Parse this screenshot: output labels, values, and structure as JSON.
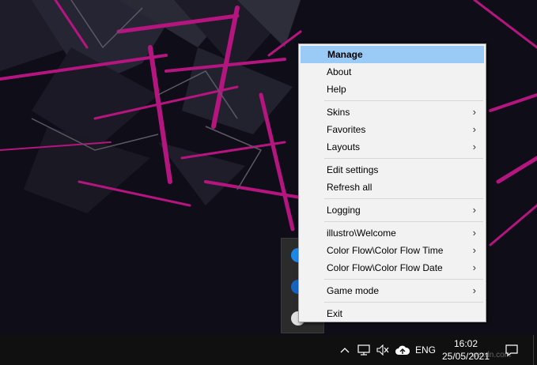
{
  "menu": {
    "groups": [
      [
        {
          "label": "Manage",
          "submenu": false,
          "highlighted": true
        },
        {
          "label": "About",
          "submenu": false
        },
        {
          "label": "Help",
          "submenu": false
        }
      ],
      [
        {
          "label": "Skins",
          "submenu": true
        },
        {
          "label": "Favorites",
          "submenu": true
        },
        {
          "label": "Layouts",
          "submenu": true
        }
      ],
      [
        {
          "label": "Edit settings",
          "submenu": false
        },
        {
          "label": "Refresh all",
          "submenu": false
        }
      ],
      [
        {
          "label": "Logging",
          "submenu": true
        }
      ],
      [
        {
          "label": "illustro\\Welcome",
          "submenu": true
        },
        {
          "label": "Color Flow\\Color Flow Time",
          "submenu": true
        },
        {
          "label": "Color Flow\\Color Flow Date",
          "submenu": true
        }
      ],
      [
        {
          "label": "Game mode",
          "submenu": true
        }
      ],
      [
        {
          "label": "Exit",
          "submenu": false
        }
      ]
    ],
    "submenu_glyph": "›"
  },
  "taskbar": {
    "language": "ENG",
    "time": "16:02",
    "date": "25/05/2021",
    "icons": [
      "chevron-up-icon",
      "network-icon",
      "volume-muted-icon",
      "cloud-upload-icon",
      "notification-icon"
    ]
  },
  "watermark": "wsxdn.com",
  "colors": {
    "menu_highlight": "#99cbf6",
    "menu_bg": "#f2f2f2",
    "wallpaper_accent": "#b5157f",
    "taskbar_bg": "#101010"
  }
}
